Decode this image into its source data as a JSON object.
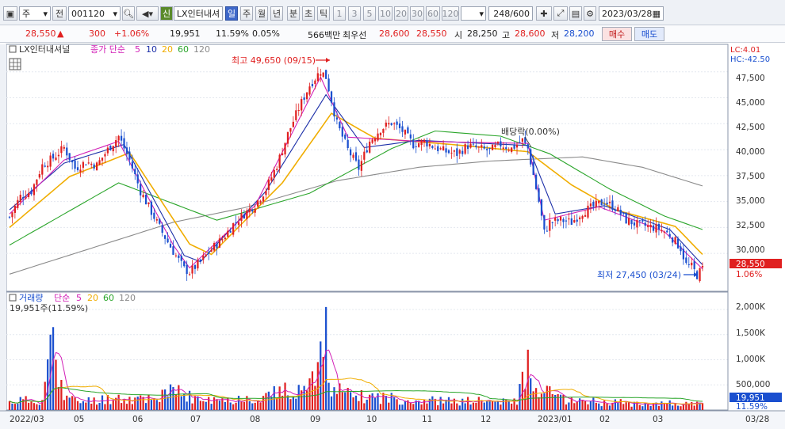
{
  "toolbar": {
    "market": "주",
    "period_prefix": "전",
    "code": "001120",
    "new_badge": "신",
    "stock_name": "LX인터내셔",
    "periods": [
      "일",
      "주",
      "월",
      "년",
      "분",
      "초",
      "틱"
    ],
    "numbers": [
      "1",
      "3",
      "5",
      "10",
      "20",
      "30",
      "60",
      "120"
    ],
    "count": "248",
    "count_total": "/600",
    "date": "2023/03/28"
  },
  "quote": {
    "price": "28,550",
    "change": "300",
    "change_pct": "+1.06%",
    "volume": "19,951",
    "vol_pct": "11.59%",
    "turnover": "0.05%",
    "amount": "566백만",
    "best_label": "최우선",
    "ask": "28,600",
    "bid": "28,550",
    "open_label": "시",
    "open": "28,250",
    "high_label": "고",
    "high": "28,600",
    "low_label": "저",
    "low": "28,200",
    "buy_label": "매수",
    "sell_label": "매도"
  },
  "price_legend": {
    "name": "LX인터내셔널",
    "ma_label": "종가 단순",
    "ma_periods": [
      "5",
      "10",
      "20",
      "60",
      "120"
    ]
  },
  "volume_legend": {
    "name": "거래량",
    "ma_label": "단순",
    "ma_periods": [
      "5",
      "20",
      "60",
      "120"
    ],
    "current": "19,951주(11.59%)"
  },
  "annotations": {
    "high": "최고 49,650 (09/15)",
    "low": "최저 27,450 (03/24)",
    "dividend": "배당락(0.00%)",
    "lc": "LC:4.01",
    "hc": "HC:-42.50"
  },
  "price_axis": [
    "47,500",
    "45,000",
    "42,500",
    "40,000",
    "37,500",
    "35,000",
    "32,500",
    "30,000"
  ],
  "volume_axis": [
    "2,000K",
    "1,500K",
    "1,000K",
    "500,000"
  ],
  "x_axis": [
    "2022/03",
    "05",
    "06",
    "07",
    "08",
    "09",
    "10",
    "11",
    "12",
    "2023/01",
    "02",
    "03"
  ],
  "right_axis_bottom": "03/28",
  "price_tag": "28,550",
  "price_tag_pct": "1.06%",
  "volume_tag": "19,951",
  "volume_tag_pct": "11.59%",
  "colors": {
    "up": "#e02020",
    "down": "#1a4fcf",
    "ma5": "#d21fb7",
    "ma10": "#1c2fa8",
    "ma20": "#f0ad00",
    "ma60": "#2aa52a",
    "ma120": "#8a8a8a"
  },
  "chart_data": {
    "type": "candlestick",
    "price_points": [
      [
        0,
        33500
      ],
      [
        4,
        35500
      ],
      [
        8,
        36000
      ],
      [
        12,
        38500
      ],
      [
        16,
        39200
      ],
      [
        20,
        40200
      ],
      [
        24,
        38200
      ],
      [
        28,
        38800
      ],
      [
        32,
        38500
      ],
      [
        36,
        40000
      ],
      [
        40,
        41300
      ],
      [
        44,
        39000
      ],
      [
        48,
        36000
      ],
      [
        52,
        34000
      ],
      [
        56,
        32000
      ],
      [
        60,
        30200
      ],
      [
        64,
        28500
      ],
      [
        66,
        28200
      ],
      [
        70,
        29200
      ],
      [
        74,
        30400
      ],
      [
        78,
        31400
      ],
      [
        82,
        32800
      ],
      [
        86,
        33800
      ],
      [
        90,
        34700
      ],
      [
        94,
        36200
      ],
      [
        98,
        38500
      ],
      [
        102,
        41500
      ],
      [
        106,
        44000
      ],
      [
        110,
        46200
      ],
      [
        114,
        47600
      ],
      [
        116,
        47000
      ],
      [
        120,
        42500
      ],
      [
        124,
        40000
      ],
      [
        128,
        38200
      ],
      [
        132,
        40800
      ],
      [
        136,
        42000
      ],
      [
        140,
        42600
      ],
      [
        144,
        41800
      ],
      [
        148,
        40500
      ],
      [
        152,
        40800
      ],
      [
        156,
        40200
      ],
      [
        160,
        39800
      ],
      [
        164,
        39600
      ],
      [
        168,
        40400
      ],
      [
        172,
        40100
      ],
      [
        176,
        39900
      ],
      [
        180,
        40500
      ],
      [
        184,
        40100
      ],
      [
        188,
        40900
      ],
      [
        190,
        40100
      ],
      [
        194,
        35000
      ],
      [
        196,
        32000
      ],
      [
        198,
        33000
      ],
      [
        202,
        33200
      ],
      [
        206,
        33000
      ],
      [
        210,
        34000
      ],
      [
        214,
        34500
      ],
      [
        218,
        35000
      ],
      [
        222,
        34400
      ],
      [
        226,
        33200
      ],
      [
        230,
        32800
      ],
      [
        234,
        32600
      ],
      [
        238,
        32400
      ],
      [
        242,
        31800
      ],
      [
        246,
        30500
      ],
      [
        248,
        28900
      ],
      [
        250,
        28700
      ],
      [
        252,
        27900
      ],
      [
        254,
        28550
      ]
    ],
    "volume_points": [
      [
        0,
        180
      ],
      [
        4,
        230
      ],
      [
        8,
        210
      ],
      [
        12,
        250
      ],
      [
        16,
        1650
      ],
      [
        20,
        270
      ],
      [
        24,
        220
      ],
      [
        28,
        200
      ],
      [
        32,
        250
      ],
      [
        36,
        260
      ],
      [
        40,
        300
      ],
      [
        44,
        240
      ],
      [
        48,
        280
      ],
      [
        52,
        310
      ],
      [
        56,
        330
      ],
      [
        60,
        420
      ],
      [
        64,
        380
      ],
      [
        68,
        250
      ],
      [
        72,
        230
      ],
      [
        76,
        210
      ],
      [
        80,
        230
      ],
      [
        84,
        260
      ],
      [
        88,
        310
      ],
      [
        92,
        290
      ],
      [
        96,
        360
      ],
      [
        100,
        420
      ],
      [
        104,
        460
      ],
      [
        108,
        560
      ],
      [
        112,
        640
      ],
      [
        116,
        2050
      ],
      [
        118,
        620
      ],
      [
        122,
        380
      ],
      [
        126,
        320
      ],
      [
        130,
        300
      ],
      [
        134,
        310
      ],
      [
        138,
        290
      ],
      [
        142,
        260
      ],
      [
        146,
        250
      ],
      [
        150,
        220
      ],
      [
        154,
        230
      ],
      [
        158,
        210
      ],
      [
        162,
        200
      ],
      [
        166,
        190
      ],
      [
        170,
        220
      ],
      [
        174,
        200
      ],
      [
        178,
        190
      ],
      [
        182,
        180
      ],
      [
        186,
        210
      ],
      [
        190,
        1200
      ],
      [
        192,
        330
      ],
      [
        196,
        420
      ],
      [
        200,
        310
      ],
      [
        204,
        260
      ],
      [
        208,
        230
      ],
      [
        212,
        210
      ],
      [
        216,
        190
      ],
      [
        220,
        180
      ],
      [
        224,
        170
      ],
      [
        228,
        160
      ],
      [
        232,
        170
      ],
      [
        236,
        160
      ],
      [
        240,
        150
      ],
      [
        244,
        160
      ],
      [
        248,
        140
      ],
      [
        252,
        130
      ],
      [
        254,
        120
      ]
    ],
    "ma5": [
      [
        0,
        33800
      ],
      [
        20,
        39000
      ],
      [
        40,
        40800
      ],
      [
        60,
        30800
      ],
      [
        66,
        28600
      ],
      [
        90,
        34600
      ],
      [
        114,
        47000
      ],
      [
        124,
        41200
      ],
      [
        150,
        40800
      ],
      [
        190,
        40600
      ],
      [
        196,
        33200
      ],
      [
        216,
        34500
      ],
      [
        240,
        32100
      ],
      [
        254,
        28500
      ]
    ],
    "ma10": [
      [
        0,
        34200
      ],
      [
        20,
        38700
      ],
      [
        42,
        40500
      ],
      [
        64,
        29800
      ],
      [
        70,
        29200
      ],
      [
        94,
        36000
      ],
      [
        116,
        45300
      ],
      [
        130,
        40200
      ],
      [
        150,
        40900
      ],
      [
        190,
        40400
      ],
      [
        200,
        33800
      ],
      [
        218,
        34600
      ],
      [
        242,
        32300
      ],
      [
        254,
        28900
      ]
    ],
    "ma20": [
      [
        0,
        32500
      ],
      [
        22,
        37400
      ],
      [
        44,
        39700
      ],
      [
        66,
        30900
      ],
      [
        74,
        29900
      ],
      [
        100,
        36800
      ],
      [
        118,
        43500
      ],
      [
        134,
        41100
      ],
      [
        162,
        40500
      ],
      [
        190,
        39800
      ],
      [
        206,
        36600
      ],
      [
        222,
        34200
      ],
      [
        244,
        32600
      ],
      [
        254,
        29900
      ]
    ],
    "ma60": [
      [
        0,
        30800
      ],
      [
        40,
        36800
      ],
      [
        60,
        34800
      ],
      [
        76,
        33200
      ],
      [
        110,
        35800
      ],
      [
        140,
        40100
      ],
      [
        156,
        41800
      ],
      [
        180,
        41300
      ],
      [
        198,
        39600
      ],
      [
        220,
        36200
      ],
      [
        240,
        33600
      ],
      [
        254,
        32300
      ]
    ],
    "ma120": [
      [
        0,
        28000
      ],
      [
        30,
        30500
      ],
      [
        60,
        33000
      ],
      [
        86,
        34400
      ],
      [
        120,
        37000
      ],
      [
        150,
        38300
      ],
      [
        176,
        38900
      ],
      [
        210,
        39300
      ],
      [
        232,
        38300
      ],
      [
        254,
        36500
      ]
    ],
    "ylim_price": [
      26500,
      50000
    ],
    "ylim_volume": [
      0,
      2300
    ],
    "xlabel": "",
    "ylabel": ""
  }
}
